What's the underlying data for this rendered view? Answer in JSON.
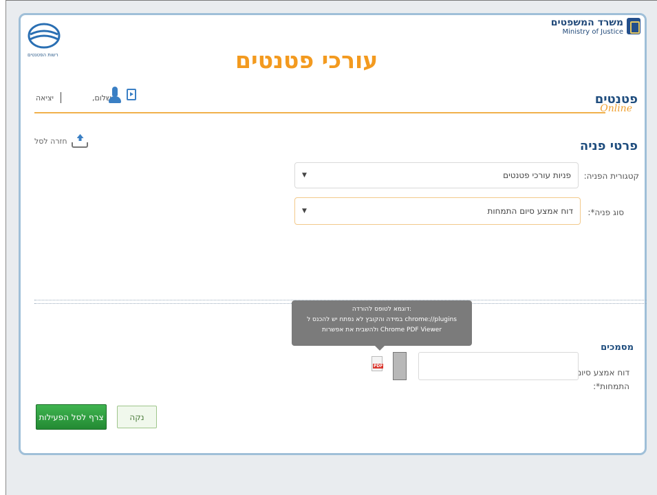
{
  "header": {
    "page_title": "עורכי פטנטים",
    "ministry_heb": "משרד המשפטים",
    "ministry_eng": "Ministry of Justice",
    "agency_caption": "רשות הפטנטים"
  },
  "topbar": {
    "logout": "יציאה",
    "greeting": "שלום,",
    "brand_heb": "פטנטים",
    "brand_online": "Online"
  },
  "form": {
    "section_title": "פרטי פניה",
    "back_link": "חזרה לסל",
    "category_label": "קטגורית הפניה:",
    "category_value": "פניות עורכי פטנטים",
    "type_label": "סוג פניה*:",
    "type_value": "דוח אמצע סיום התמחות"
  },
  "documents": {
    "title": "מסמכים",
    "field_label": "דוח אמצע סיום התמחות*:",
    "pdf_badge": "PDF",
    "tooltip": [
      "דוגמא לטופס להורדה:",
      "במידה והקובץ לא נפתח יש להכנס ל chrome://plugins",
      "ולהשבית את אפשרות Chrome PDF Viewer"
    ]
  },
  "actions": {
    "attach": "צרף לסל הפעילות",
    "clear": "נקה"
  },
  "colors": {
    "title": "#f39a1f",
    "brand_blue": "#1f4d7e",
    "accent_line": "#f0b04a",
    "attach_button": "#2ea043"
  }
}
